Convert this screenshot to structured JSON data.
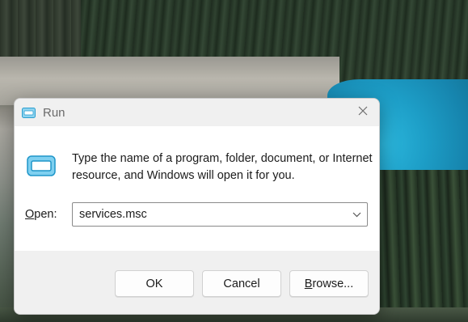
{
  "dialog": {
    "title": "Run",
    "close_icon": "close-icon",
    "app_icon": "run-icon",
    "description": "Type the name of a program, folder, document, or Internet resource, and Windows will open it for you.",
    "open_label_prefix": "O",
    "open_label_rest": "pen:",
    "open_value": "services.msc",
    "buttons": {
      "ok": "OK",
      "cancel": "Cancel",
      "browse_prefix": "B",
      "browse_rest": "rowse..."
    }
  },
  "colors": {
    "accent": "#2aa7d8",
    "dialog_bg": "#f3f3f3",
    "content_bg": "#ffffff"
  }
}
